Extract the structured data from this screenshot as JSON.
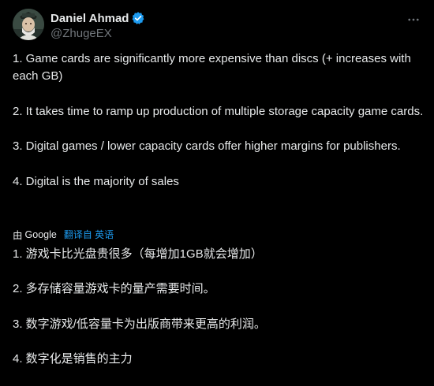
{
  "author": {
    "display_name": "Daniel Ahmad",
    "handle": "@ZhugeEX",
    "verified_color": "#1d9bf0"
  },
  "icons": {
    "verified": "verified-badge-icon",
    "more": "more-options-icon"
  },
  "original_paragraphs": [
    "1. Game cards are significantly more expensive than discs (+ increases with each GB)",
    "2. It takes time to ramp up production of multiple storage capacity game cards.",
    "3. Digital games / lower capacity cards offer higher margins for publishers.",
    "4. Digital is the majority of sales"
  ],
  "translation": {
    "by_prefix": "由",
    "provider": "Google",
    "link_label": "翻译自 英语"
  },
  "translated_paragraphs": [
    "1. 游戏卡比光盘贵很多（每增加1GB就会增加）",
    "2. 多存储容量游戏卡的量产需要时间。",
    "3. 数字游戏/低容量卡为出版商带来更高的利润。",
    "4. 数字化是销售的主力"
  ],
  "colors": {
    "background": "#000000",
    "text": "#e7e9ea",
    "muted": "#71767b",
    "accent": "#1d9bf0"
  }
}
